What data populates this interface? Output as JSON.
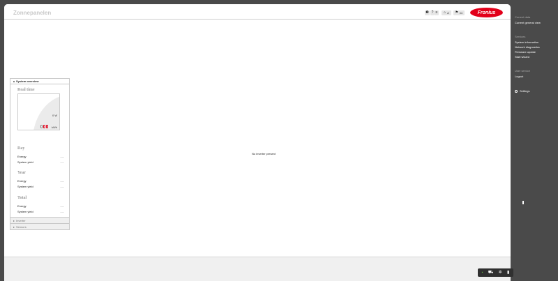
{
  "header": {
    "title": "Zonnepanelen",
    "buttons": [
      {
        "icon": "info-icon",
        "glyph": "❶",
        "label": ""
      },
      {
        "icon": "help-icon",
        "glyph": "?",
        "label": ""
      },
      {
        "icon": "list-icon",
        "glyph": "≡",
        "label": ""
      },
      {
        "icon": "home-icon",
        "glyph": "⌂",
        "label": "A"
      },
      {
        "icon": "flag-icon",
        "glyph": "⚑",
        "label": "en"
      }
    ],
    "logo_text": "Fronius",
    "logo_color": "#e2001a"
  },
  "panel": {
    "overview_label": "System overview",
    "realtime_title": "Real time",
    "gauge_value": "0 W",
    "gauge_unit": "kWh",
    "day": {
      "title": "Day",
      "energy_label": "Energy",
      "energy_value": "---",
      "yield_label": "System yield",
      "yield_value": "---"
    },
    "year": {
      "title": "Year",
      "energy_label": "Energy",
      "energy_value": "---",
      "yield_label": "System yield",
      "yield_value": "---"
    },
    "total": {
      "title": "Total",
      "energy_label": "Energy",
      "energy_value": "---",
      "yield_label": "System yield",
      "yield_value": "---"
    },
    "inverter_label": "Inverter",
    "sensors_label": "Sensors"
  },
  "main": {
    "empty_message": "No inverter present"
  },
  "sidebar": {
    "current_data_head": "Current data",
    "current_general_view": "Current general view",
    "services_head": "Services",
    "services": [
      "System information",
      "Network diagnostics",
      "Firmware update",
      "Start wizard"
    ],
    "user_service_head": "User service",
    "logout": "Logout",
    "settings": "Settings"
  },
  "bottom_bar": {
    "icons": [
      "status-icon",
      "car-icon",
      "gear-icon",
      "mobile-icon"
    ]
  }
}
